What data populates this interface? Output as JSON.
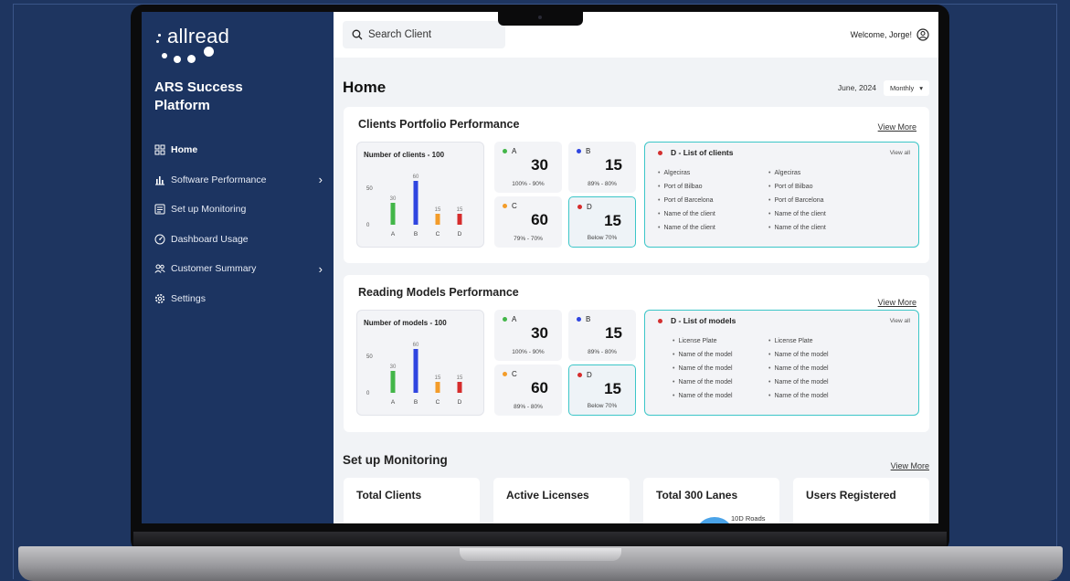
{
  "sidebar": {
    "logo_text": "allread",
    "platform_name": "ARS Success Platform",
    "items": [
      {
        "label": "Home",
        "icon": "grid-icon",
        "active": true,
        "has_chevron": false
      },
      {
        "label": "Software Performance",
        "icon": "bar-chart-icon",
        "active": false,
        "has_chevron": true
      },
      {
        "label": "Set up Monitoring",
        "icon": "monitor-list-icon",
        "active": false,
        "has_chevron": false
      },
      {
        "label": "Dashboard Usage",
        "icon": "gauge-icon",
        "active": false,
        "has_chevron": false
      },
      {
        "label": "Customer Summary",
        "icon": "users-icon",
        "active": false,
        "has_chevron": true
      },
      {
        "label": "Settings",
        "icon": "gear-icon",
        "active": false,
        "has_chevron": false
      }
    ]
  },
  "topbar": {
    "search_placeholder": "Search Client",
    "welcome": "Welcome, Jorge!"
  },
  "page": {
    "title": "Home",
    "date": "June, 2024",
    "period": "Monthly"
  },
  "clients_panel": {
    "title": "Clients Portfolio Performance",
    "view_more": "View More",
    "count_title": "Number of clients - 100",
    "chart": {
      "categories": [
        "A",
        "B",
        "C",
        "D"
      ],
      "values": [
        30,
        60,
        15,
        15
      ],
      "ticks": [
        0,
        50
      ],
      "colors": [
        "#43b649",
        "#2f45e0",
        "#f39c2a",
        "#d62c2c"
      ]
    },
    "grades": [
      {
        "letter": "A",
        "value": "30",
        "range": "100% - 90%",
        "color": "#43b649"
      },
      {
        "letter": "B",
        "value": "15",
        "range": "89% - 80%",
        "color": "#2f45e0"
      },
      {
        "letter": "C",
        "value": "60",
        "range": "79% - 70%",
        "color": "#f39c2a"
      },
      {
        "letter": "D",
        "value": "15",
        "range": "Below 70%",
        "color": "#d62c2c"
      }
    ],
    "list": {
      "title": "D - List of clients",
      "view_all": "View all",
      "col1": [
        "Algeciras",
        "Port of Bilbao",
        "Port of Barcelona",
        "Name of the client",
        "Name of the client"
      ],
      "col2": [
        "Algeciras",
        "Port of Bilbao",
        "Port of Barcelona",
        "Name of the client",
        "Name of the client"
      ]
    }
  },
  "models_panel": {
    "title": "Reading Models Performance",
    "view_more": "View More",
    "count_title": "Number of models - 100",
    "chart": {
      "categories": [
        "A",
        "B",
        "C",
        "D"
      ],
      "values": [
        30,
        60,
        15,
        15
      ],
      "ticks": [
        0,
        50
      ],
      "colors": [
        "#43b649",
        "#2f45e0",
        "#f39c2a",
        "#d62c2c"
      ]
    },
    "grades": [
      {
        "letter": "A",
        "value": "30",
        "range": "100% - 90%",
        "color": "#43b649"
      },
      {
        "letter": "B",
        "value": "15",
        "range": "89% - 80%",
        "color": "#2f45e0"
      },
      {
        "letter": "C",
        "value": "60",
        "range": "89% - 80%",
        "color": "#f39c2a"
      },
      {
        "letter": "D",
        "value": "15",
        "range": "Below 70%",
        "color": "#d62c2c"
      }
    ],
    "list": {
      "title": "D - List of models",
      "view_all": "View all",
      "col1": [
        "License Plate",
        "Name of the model",
        "Name of the model",
        "Name of the model",
        "Name of the model"
      ],
      "col2": [
        "License Plate",
        "Name of the model",
        "Name of the model",
        "Name of the model",
        "Name of the model"
      ]
    }
  },
  "monitoring": {
    "title": "Set up Monitoring",
    "view_more": "View More",
    "cards": [
      {
        "title": "Total Clients"
      },
      {
        "title": "Active Licenses"
      },
      {
        "title": "Total 300 Lanes",
        "extra": "10D Roads"
      },
      {
        "title": "Users Registered"
      }
    ]
  },
  "chart_data": [
    {
      "type": "bar",
      "title": "Number of clients - 100",
      "categories": [
        "A",
        "B",
        "C",
        "D"
      ],
      "values": [
        30,
        60,
        15,
        15
      ],
      "ylim": [
        0,
        60
      ]
    },
    {
      "type": "bar",
      "title": "Number of models - 100",
      "categories": [
        "A",
        "B",
        "C",
        "D"
      ],
      "values": [
        30,
        60,
        15,
        15
      ],
      "ylim": [
        0,
        60
      ]
    }
  ]
}
